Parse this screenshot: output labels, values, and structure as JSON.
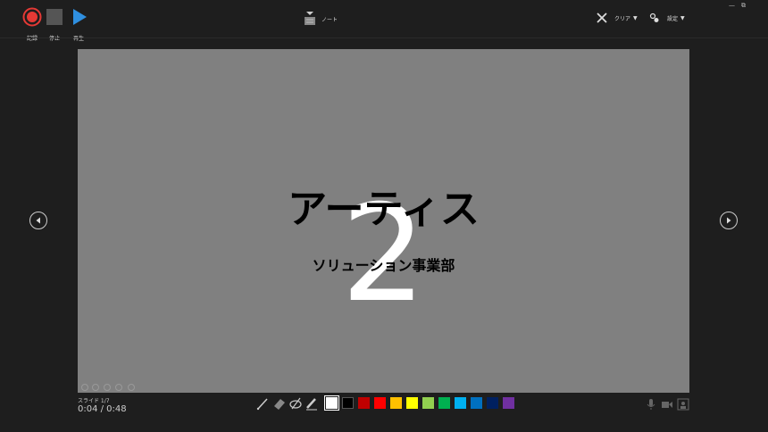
{
  "toolbar": {
    "record_label": "記録",
    "stop_label": "停止",
    "play_label": "再生",
    "notes_label": "ノート",
    "clear_label": "クリア",
    "settings_label": "設定"
  },
  "slide": {
    "number": "2",
    "title": "アーティス",
    "subtitle": "ソリューション事業部"
  },
  "status": {
    "slide_position": "スライド 1/7",
    "time": "0:04 / 0:48"
  },
  "pen_colors": [
    "#ffffff",
    "#000000",
    "#c00000",
    "#ff0000",
    "#ffc000",
    "#ffff00",
    "#92d050",
    "#00b050",
    "#00b0f0",
    "#0070c0",
    "#002060",
    "#7030a0"
  ],
  "selected_color": "#ffffff"
}
